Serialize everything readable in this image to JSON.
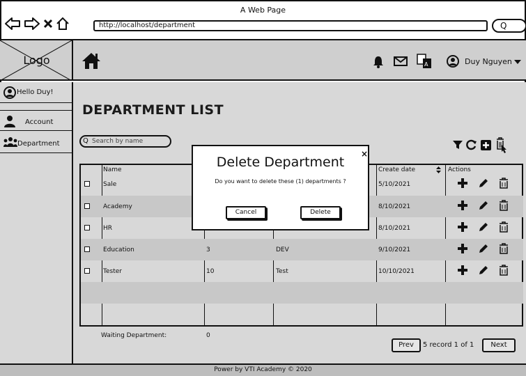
{
  "browser": {
    "window_title": "A Web Page",
    "url": "http://localhost/department",
    "search_button": "Q"
  },
  "header": {
    "logo": "Logo",
    "user_name": "Duy Nguyen"
  },
  "sidebar": {
    "items": [
      {
        "label": "Hello Duy!",
        "icon": "user-circle-icon"
      },
      {
        "label": "Account",
        "icon": "user-icon"
      },
      {
        "label": "Department",
        "icon": "users-icon"
      }
    ]
  },
  "main": {
    "title": "DEPARTMENT LIST",
    "search_placeholder": "Search by name",
    "table": {
      "headers": {
        "name": "Name",
        "create_date": "Create date",
        "actions": "Actions"
      },
      "rows": [
        {
          "name": "Sale",
          "members": "",
          "type": "",
          "create_date": "5/10/2021"
        },
        {
          "name": "Academy",
          "members": "",
          "type": "",
          "create_date": "8/10/2021"
        },
        {
          "name": "HR",
          "members": "",
          "type": "",
          "create_date": "8/10/2021"
        },
        {
          "name": "Education",
          "members": "3",
          "type": "DEV",
          "create_date": "9/10/2021"
        },
        {
          "name": "Tester",
          "members": "10",
          "type": "Test",
          "create_date": "10/10/2021"
        }
      ]
    },
    "waiting_label": "Waiting Department:",
    "waiting_value": "0",
    "pagination": {
      "prev": "Prev",
      "info": "5 record 1 of 1",
      "next": "Next"
    }
  },
  "footer": {
    "text": "Power by VTI Academy © 2020"
  },
  "modal": {
    "title": "Delete Department",
    "close": "×",
    "message": "Do you want to delete these (1) departments ?",
    "cancel": "Cancel",
    "delete": "Delete"
  }
}
